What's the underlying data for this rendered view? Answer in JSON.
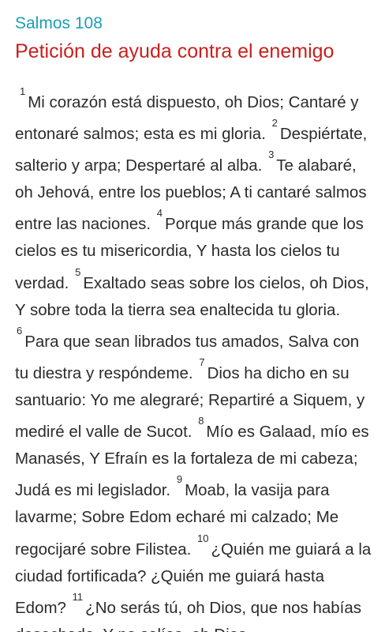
{
  "header": {
    "book_ref": "Salmos 108",
    "chapter_title": "Petición de ayuda contra el enemigo"
  },
  "verses": [
    {
      "num": "1",
      "text": "Mi corazón está dispuesto, oh Dios; Cantaré y entonaré salmos; esta es mi gloria."
    },
    {
      "num": "2",
      "text": "Despiértate, salterio y arpa; Despertaré al alba."
    },
    {
      "num": "3",
      "text": "Te alabaré, oh Jehová, entre los pueblos; A ti cantaré salmos entre las naciones."
    },
    {
      "num": "4",
      "text": "Porque más grande que los cielos es tu misericordia, Y hasta los cielos tu verdad."
    },
    {
      "num": "5",
      "text": "Exaltado seas sobre los cielos, oh Dios, Y sobre toda la tierra sea enaltecida tu gloria."
    },
    {
      "num": "6",
      "text": "Para que sean librados tus amados, Salva con tu diestra y respóndeme."
    },
    {
      "num": "7",
      "text": "Dios ha dicho en su santuario: Yo me alegraré; Repartiré a Siquem, y mediré el valle de Sucot."
    },
    {
      "num": "8",
      "text": "Mío es Galaad, mío es Manasés, Y Efraín es la fortaleza de mi cabeza; Judá es mi legislador."
    },
    {
      "num": "9",
      "text": "Moab, la vasija para lavarme; Sobre Edom echaré mi calzado; Me regocijaré sobre Filistea."
    },
    {
      "num": "10",
      "text": "¿Quién me guiará a la ciudad fortificada? ¿Quién me guiará hasta Edom?"
    },
    {
      "num": "11",
      "text": "¿No serás tú, oh Dios, que nos habías desechado, Y no salías, oh Dios,"
    }
  ]
}
